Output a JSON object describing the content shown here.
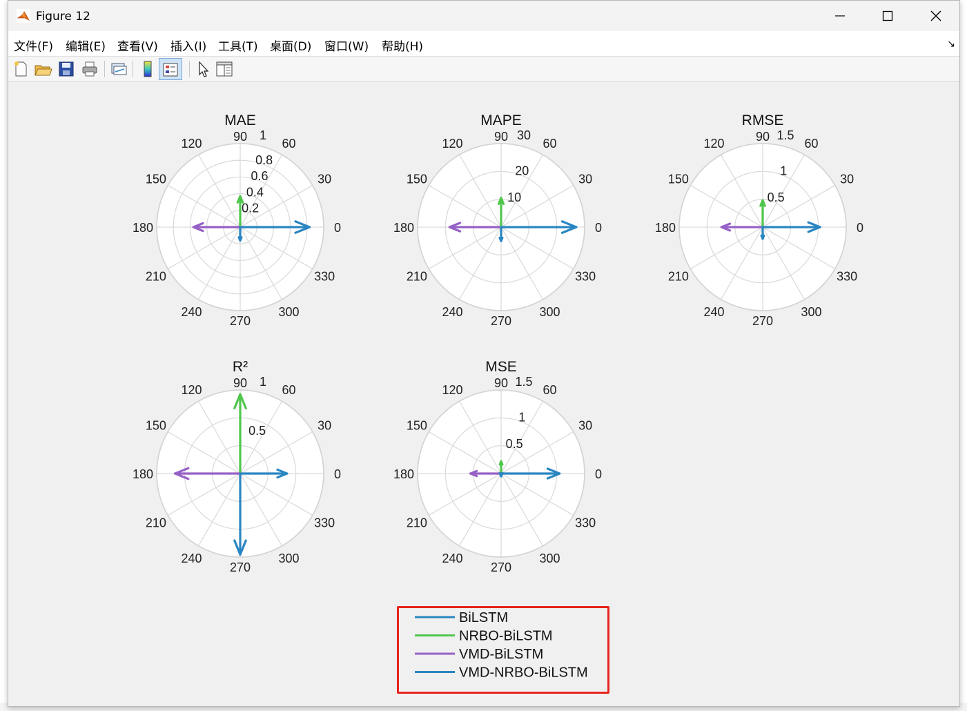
{
  "window": {
    "title": "Figure 12",
    "controls": {
      "minimize": "minimize",
      "maximize": "maximize",
      "close": "close"
    }
  },
  "menu": {
    "items": [
      "文件(F)",
      "编辑(E)",
      "查看(V)",
      "插入(I)",
      "工具(T)",
      "桌面(D)",
      "窗口(W)",
      "帮助(H)"
    ]
  },
  "toolbar": {
    "icons": [
      "new-figure-icon",
      "open-file-icon",
      "save-icon",
      "print-icon",
      "link-plot-icon",
      "colorbar-icon",
      "legend-icon",
      "pointer-icon",
      "property-editor-icon"
    ]
  },
  "colors": {
    "BiLSTM": "#2a86c2",
    "NRBO-BiLSTM": "#4fc64c",
    "VMD-BiLSTM": "#9661c6",
    "VMD-NRBO-BiLSTM": "#2a86c2",
    "highlight": "#e8231d"
  },
  "chart_data": [
    {
      "type": "compass",
      "title": "MAE",
      "angle_ticks": [
        0,
        30,
        60,
        90,
        120,
        150,
        180,
        210,
        240,
        270,
        300,
        330
      ],
      "rmax": 1,
      "r_ticks": [
        "0.2",
        "0.4",
        "0.6",
        "0.8",
        "1"
      ],
      "r_ticks_values": [
        0.2,
        0.4,
        0.6,
        0.8,
        1
      ],
      "series": [
        {
          "name": "BiLSTM",
          "angle": 0,
          "value": 0.83
        },
        {
          "name": "NRBO-BiLSTM",
          "angle": 90,
          "value": 0.37
        },
        {
          "name": "VMD-BiLSTM",
          "angle": 180,
          "value": 0.56
        },
        {
          "name": "VMD-NRBO-BiLSTM",
          "angle": 270,
          "value": 0.16
        }
      ]
    },
    {
      "type": "compass",
      "title": "MAPE",
      "angle_ticks": [
        0,
        30,
        60,
        90,
        120,
        150,
        180,
        210,
        240,
        270,
        300,
        330
      ],
      "rmax": 30,
      "r_ticks": [
        "10",
        "20",
        "30"
      ],
      "r_ticks_values": [
        10,
        20,
        30
      ],
      "series": [
        {
          "name": "BiLSTM",
          "angle": 0,
          "value": 27
        },
        {
          "name": "NRBO-BiLSTM",
          "angle": 90,
          "value": 10.5
        },
        {
          "name": "VMD-BiLSTM",
          "angle": 180,
          "value": 18.5
        },
        {
          "name": "VMD-NRBO-BiLSTM",
          "angle": 270,
          "value": 5
        }
      ]
    },
    {
      "type": "compass",
      "title": "RMSE",
      "angle_ticks": [
        0,
        30,
        60,
        90,
        120,
        150,
        180,
        210,
        240,
        270,
        300,
        330
      ],
      "rmax": 1.5,
      "r_ticks": [
        "0.5",
        "1",
        "1.5"
      ],
      "r_ticks_values": [
        0.5,
        1,
        1.5
      ],
      "series": [
        {
          "name": "BiLSTM",
          "angle": 0,
          "value": 1.03
        },
        {
          "name": "NRBO-BiLSTM",
          "angle": 90,
          "value": 0.48
        },
        {
          "name": "VMD-BiLSTM",
          "angle": 180,
          "value": 0.74
        },
        {
          "name": "VMD-NRBO-BiLSTM",
          "angle": 270,
          "value": 0.21
        }
      ]
    },
    {
      "type": "compass",
      "title": "R²",
      "angle_ticks": [
        0,
        30,
        60,
        90,
        120,
        150,
        180,
        210,
        240,
        270,
        300,
        330
      ],
      "rmax": 1,
      "r_ticks": [
        "0.5",
        "1"
      ],
      "r_ticks_values": [
        0.5,
        1
      ],
      "series": [
        {
          "name": "BiLSTM",
          "angle": 0,
          "value": 0.56
        },
        {
          "name": "NRBO-BiLSTM",
          "angle": 90,
          "value": 0.95
        },
        {
          "name": "VMD-BiLSTM",
          "angle": 180,
          "value": 0.78
        },
        {
          "name": "VMD-NRBO-BiLSTM",
          "angle": 270,
          "value": 0.97
        }
      ]
    },
    {
      "type": "compass",
      "title": "MSE",
      "angle_ticks": [
        0,
        30,
        60,
        90,
        120,
        150,
        180,
        210,
        240,
        270,
        300,
        330
      ],
      "rmax": 1.5,
      "r_ticks": [
        "0.5",
        "1",
        "1.5"
      ],
      "r_ticks_values": [
        0.5,
        1,
        1.5
      ],
      "series": [
        {
          "name": "BiLSTM",
          "angle": 0,
          "value": 1.05
        },
        {
          "name": "NRBO-BiLSTM",
          "angle": 90,
          "value": 0.22
        },
        {
          "name": "VMD-BiLSTM",
          "angle": 180,
          "value": 0.55
        },
        {
          "name": "VMD-NRBO-BiLSTM",
          "angle": 270,
          "value": 0.05
        }
      ]
    }
  ],
  "legend": {
    "entries": [
      "BiLSTM",
      "NRBO-BiLSTM",
      "VMD-BiLSTM",
      "VMD-NRBO-BiLSTM"
    ],
    "placement": "bottom-center"
  }
}
